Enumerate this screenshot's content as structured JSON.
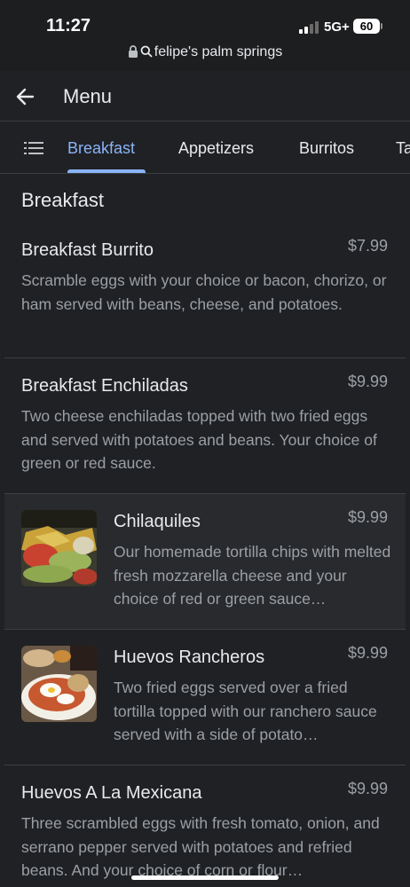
{
  "status_bar": {
    "time": "11:27",
    "network": "5G+",
    "battery": "60"
  },
  "browser": {
    "url": "felipe's palm springs"
  },
  "app_bar": {
    "title": "Menu"
  },
  "tabs": [
    {
      "label": "Breakfast",
      "active": true
    },
    {
      "label": "Appetizers",
      "active": false
    },
    {
      "label": "Burritos",
      "active": false
    },
    {
      "label": "Ta",
      "active": false
    }
  ],
  "section": {
    "title": "Breakfast"
  },
  "items": [
    {
      "name": "Breakfast Burrito",
      "price": "$7.99",
      "description": "Scramble eggs with your choice or bacon, chorizo, or ham served with beans, cheese, and potatoes."
    },
    {
      "name": "Breakfast Enchiladas",
      "price": "$9.99",
      "description": "Two cheese enchiladas topped with two fried eggs and served with potatoes and beans. Your choice of green or red sauce."
    },
    {
      "name": "Chilaquiles",
      "price": "$9.99",
      "description": "Our homemade tortilla chips with melted fresh mozzarella cheese and your choice of red or green sauce…"
    },
    {
      "name": "Huevos Rancheros",
      "price": "$9.99",
      "description": "Two fried eggs served over a fried tortilla topped with our ranchero sauce served with a side of potato…"
    },
    {
      "name": "Huevos A La Mexicana",
      "price": "$9.99",
      "description": "Three scrambled eggs with fresh tomato, onion, and serrano pepper served with potatoes and refried beans. And your choice of corn or flour…"
    }
  ],
  "colors": {
    "background": "#202124",
    "accent": "#8ab4f8",
    "text": "#e8eaed",
    "secondary_text": "#9aa0a6"
  },
  "icons": [
    "back-arrow-icon",
    "list-icon",
    "lock-icon",
    "search-icon",
    "signal-icon",
    "battery-icon"
  ]
}
